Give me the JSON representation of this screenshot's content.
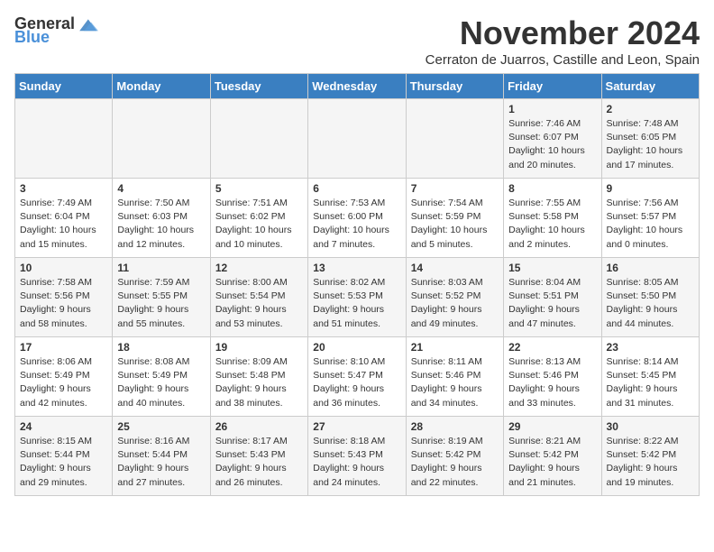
{
  "header": {
    "logo_general": "General",
    "logo_blue": "Blue",
    "month_title": "November 2024",
    "subtitle": "Cerraton de Juarros, Castille and Leon, Spain"
  },
  "weekdays": [
    "Sunday",
    "Monday",
    "Tuesday",
    "Wednesday",
    "Thursday",
    "Friday",
    "Saturday"
  ],
  "weeks": [
    [
      {
        "day": "",
        "info": ""
      },
      {
        "day": "",
        "info": ""
      },
      {
        "day": "",
        "info": ""
      },
      {
        "day": "",
        "info": ""
      },
      {
        "day": "",
        "info": ""
      },
      {
        "day": "1",
        "info": "Sunrise: 7:46 AM\nSunset: 6:07 PM\nDaylight: 10 hours and 20 minutes."
      },
      {
        "day": "2",
        "info": "Sunrise: 7:48 AM\nSunset: 6:05 PM\nDaylight: 10 hours and 17 minutes."
      }
    ],
    [
      {
        "day": "3",
        "info": "Sunrise: 7:49 AM\nSunset: 6:04 PM\nDaylight: 10 hours and 15 minutes."
      },
      {
        "day": "4",
        "info": "Sunrise: 7:50 AM\nSunset: 6:03 PM\nDaylight: 10 hours and 12 minutes."
      },
      {
        "day": "5",
        "info": "Sunrise: 7:51 AM\nSunset: 6:02 PM\nDaylight: 10 hours and 10 minutes."
      },
      {
        "day": "6",
        "info": "Sunrise: 7:53 AM\nSunset: 6:00 PM\nDaylight: 10 hours and 7 minutes."
      },
      {
        "day": "7",
        "info": "Sunrise: 7:54 AM\nSunset: 5:59 PM\nDaylight: 10 hours and 5 minutes."
      },
      {
        "day": "8",
        "info": "Sunrise: 7:55 AM\nSunset: 5:58 PM\nDaylight: 10 hours and 2 minutes."
      },
      {
        "day": "9",
        "info": "Sunrise: 7:56 AM\nSunset: 5:57 PM\nDaylight: 10 hours and 0 minutes."
      }
    ],
    [
      {
        "day": "10",
        "info": "Sunrise: 7:58 AM\nSunset: 5:56 PM\nDaylight: 9 hours and 58 minutes."
      },
      {
        "day": "11",
        "info": "Sunrise: 7:59 AM\nSunset: 5:55 PM\nDaylight: 9 hours and 55 minutes."
      },
      {
        "day": "12",
        "info": "Sunrise: 8:00 AM\nSunset: 5:54 PM\nDaylight: 9 hours and 53 minutes."
      },
      {
        "day": "13",
        "info": "Sunrise: 8:02 AM\nSunset: 5:53 PM\nDaylight: 9 hours and 51 minutes."
      },
      {
        "day": "14",
        "info": "Sunrise: 8:03 AM\nSunset: 5:52 PM\nDaylight: 9 hours and 49 minutes."
      },
      {
        "day": "15",
        "info": "Sunrise: 8:04 AM\nSunset: 5:51 PM\nDaylight: 9 hours and 47 minutes."
      },
      {
        "day": "16",
        "info": "Sunrise: 8:05 AM\nSunset: 5:50 PM\nDaylight: 9 hours and 44 minutes."
      }
    ],
    [
      {
        "day": "17",
        "info": "Sunrise: 8:06 AM\nSunset: 5:49 PM\nDaylight: 9 hours and 42 minutes."
      },
      {
        "day": "18",
        "info": "Sunrise: 8:08 AM\nSunset: 5:49 PM\nDaylight: 9 hours and 40 minutes."
      },
      {
        "day": "19",
        "info": "Sunrise: 8:09 AM\nSunset: 5:48 PM\nDaylight: 9 hours and 38 minutes."
      },
      {
        "day": "20",
        "info": "Sunrise: 8:10 AM\nSunset: 5:47 PM\nDaylight: 9 hours and 36 minutes."
      },
      {
        "day": "21",
        "info": "Sunrise: 8:11 AM\nSunset: 5:46 PM\nDaylight: 9 hours and 34 minutes."
      },
      {
        "day": "22",
        "info": "Sunrise: 8:13 AM\nSunset: 5:46 PM\nDaylight: 9 hours and 33 minutes."
      },
      {
        "day": "23",
        "info": "Sunrise: 8:14 AM\nSunset: 5:45 PM\nDaylight: 9 hours and 31 minutes."
      }
    ],
    [
      {
        "day": "24",
        "info": "Sunrise: 8:15 AM\nSunset: 5:44 PM\nDaylight: 9 hours and 29 minutes."
      },
      {
        "day": "25",
        "info": "Sunrise: 8:16 AM\nSunset: 5:44 PM\nDaylight: 9 hours and 27 minutes."
      },
      {
        "day": "26",
        "info": "Sunrise: 8:17 AM\nSunset: 5:43 PM\nDaylight: 9 hours and 26 minutes."
      },
      {
        "day": "27",
        "info": "Sunrise: 8:18 AM\nSunset: 5:43 PM\nDaylight: 9 hours and 24 minutes."
      },
      {
        "day": "28",
        "info": "Sunrise: 8:19 AM\nSunset: 5:42 PM\nDaylight: 9 hours and 22 minutes."
      },
      {
        "day": "29",
        "info": "Sunrise: 8:21 AM\nSunset: 5:42 PM\nDaylight: 9 hours and 21 minutes."
      },
      {
        "day": "30",
        "info": "Sunrise: 8:22 AM\nSunset: 5:42 PM\nDaylight: 9 hours and 19 minutes."
      }
    ]
  ]
}
